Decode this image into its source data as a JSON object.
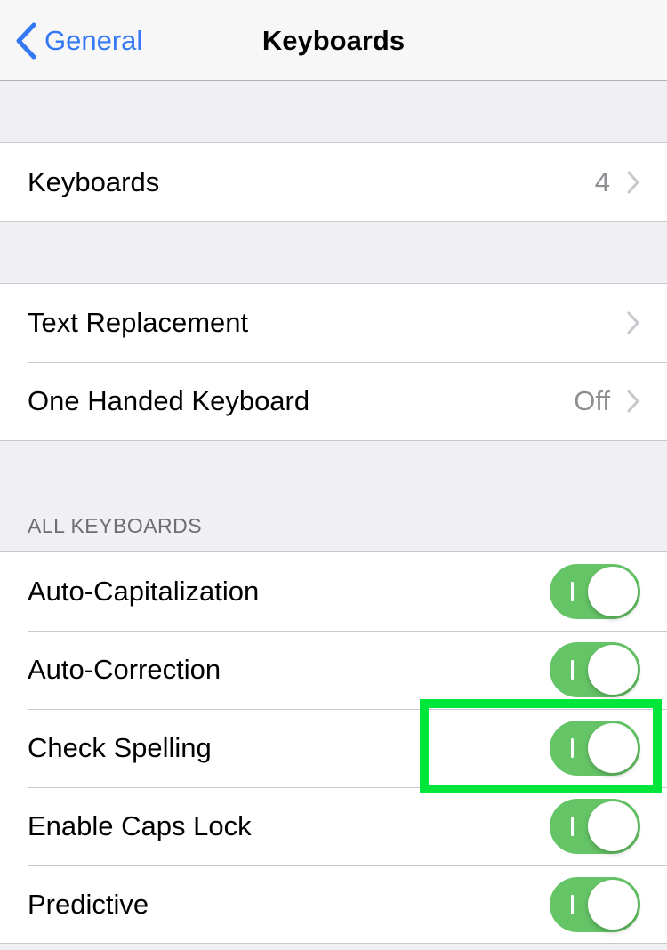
{
  "navbar": {
    "back_label": "General",
    "title": "Keyboards"
  },
  "groups": {
    "keyboards": {
      "label": "Keyboards",
      "value": "4"
    },
    "text": [
      {
        "label": "Text Replacement",
        "value": ""
      },
      {
        "label": "One Handed Keyboard",
        "value": "Off"
      }
    ]
  },
  "all_keyboards": {
    "header": "ALL KEYBOARDS",
    "items": [
      {
        "label": "Auto-Capitalization",
        "on": true
      },
      {
        "label": "Auto-Correction",
        "on": true
      },
      {
        "label": "Check Spelling",
        "on": true
      },
      {
        "label": "Enable Caps Lock",
        "on": true
      },
      {
        "label": "Predictive",
        "on": true
      }
    ]
  },
  "colors": {
    "accent": "#3478f6",
    "toggle_on": "#65c466",
    "highlight": "#00e63a"
  }
}
